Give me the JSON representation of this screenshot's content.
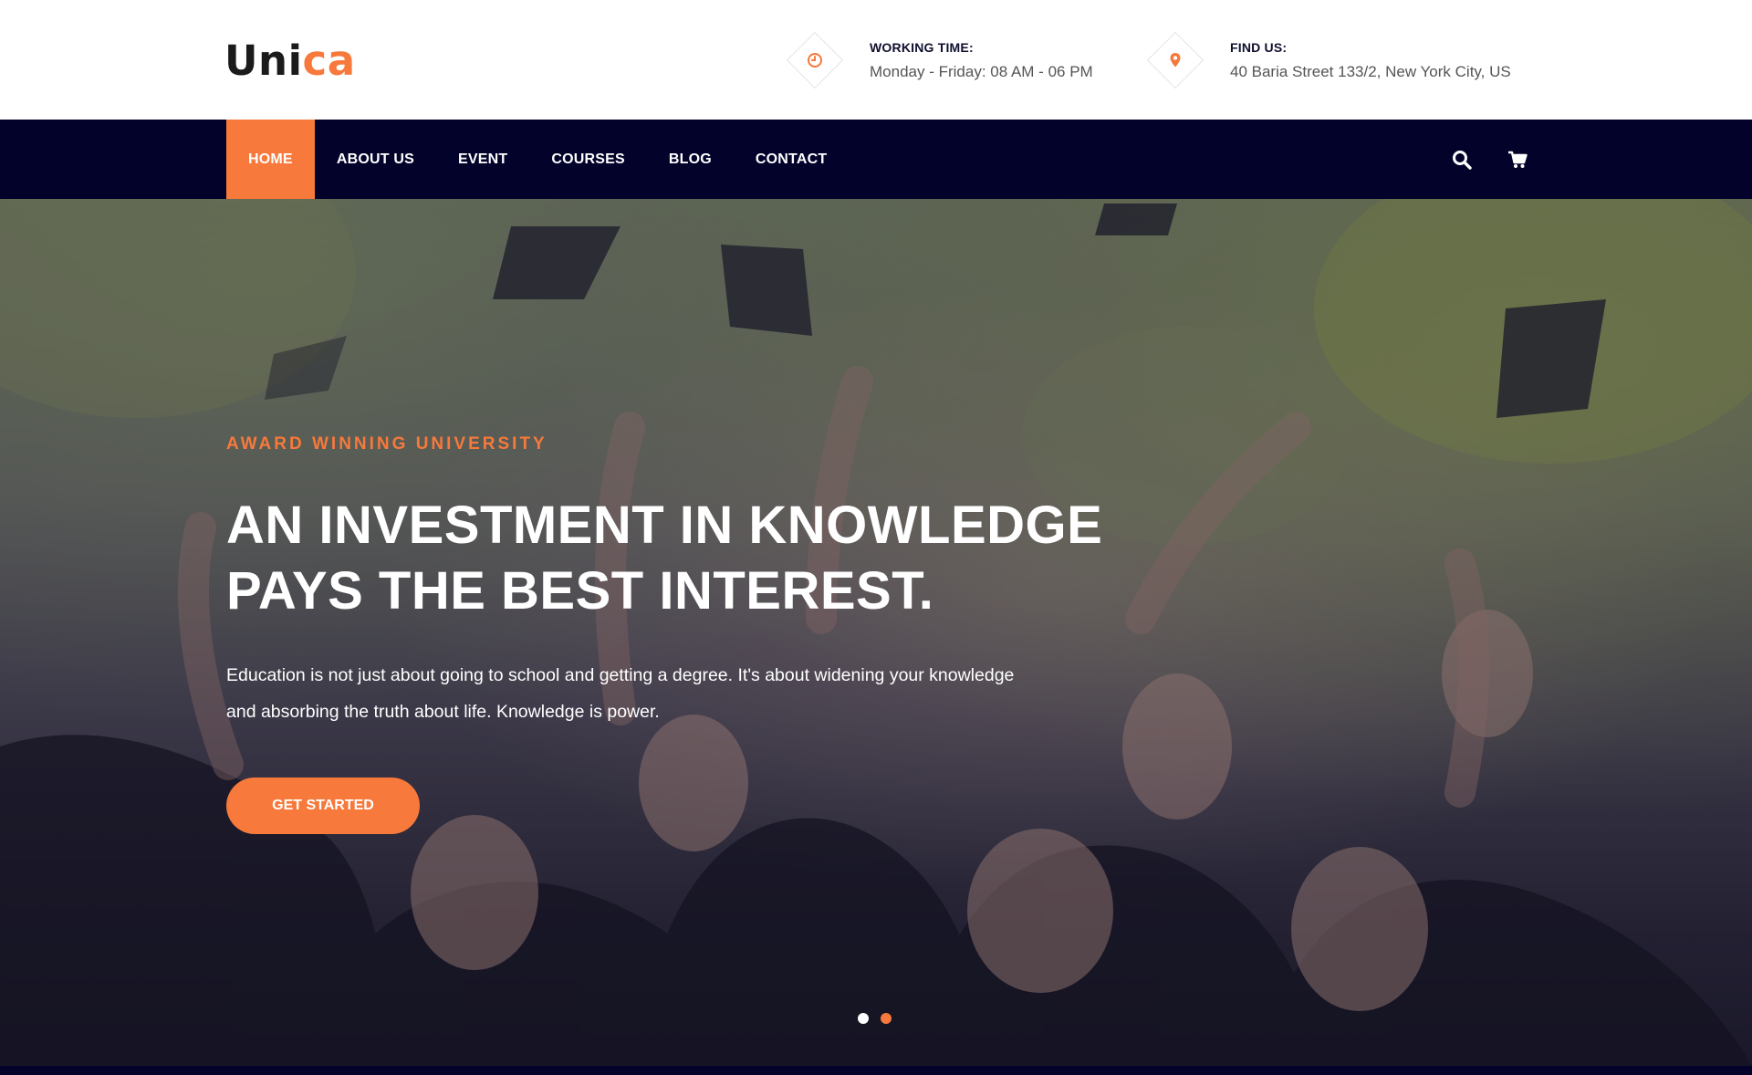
{
  "brand": {
    "name_part1": "Uni",
    "name_part2": "ca"
  },
  "info": {
    "working": {
      "icon": "clock-icon",
      "title": "WORKING TIME:",
      "value": "Monday - Friday: 08 AM - 06 PM"
    },
    "find": {
      "icon": "map-pin-icon",
      "title": "FIND US:",
      "value": "40 Baria Street 133/2, New York City, US"
    }
  },
  "nav": {
    "items": [
      {
        "label": "HOME",
        "active": true
      },
      {
        "label": "ABOUT US"
      },
      {
        "label": "EVENT"
      },
      {
        "label": "COURSES"
      },
      {
        "label": "BLOG"
      },
      {
        "label": "CONTACT"
      }
    ],
    "icons": [
      "search-icon",
      "cart-icon"
    ]
  },
  "hero": {
    "eyebrow": "AWARD WINNING UNIVERSITY",
    "headline_line1": "AN INVESTMENT IN KNOWLEDGE",
    "headline_line2": "PAYS THE BEST INTEREST.",
    "description": "Education is not just about going to school and getting a degree. It's about widening your knowledge and absorbing the truth about life. Knowledge is power.",
    "cta": "GET STARTED",
    "slides": 2,
    "active_slide": 2
  },
  "colors": {
    "accent": "#f7793b",
    "navy": "#02022a",
    "text_dark": "#0f0f2e",
    "text_muted": "#555555"
  }
}
